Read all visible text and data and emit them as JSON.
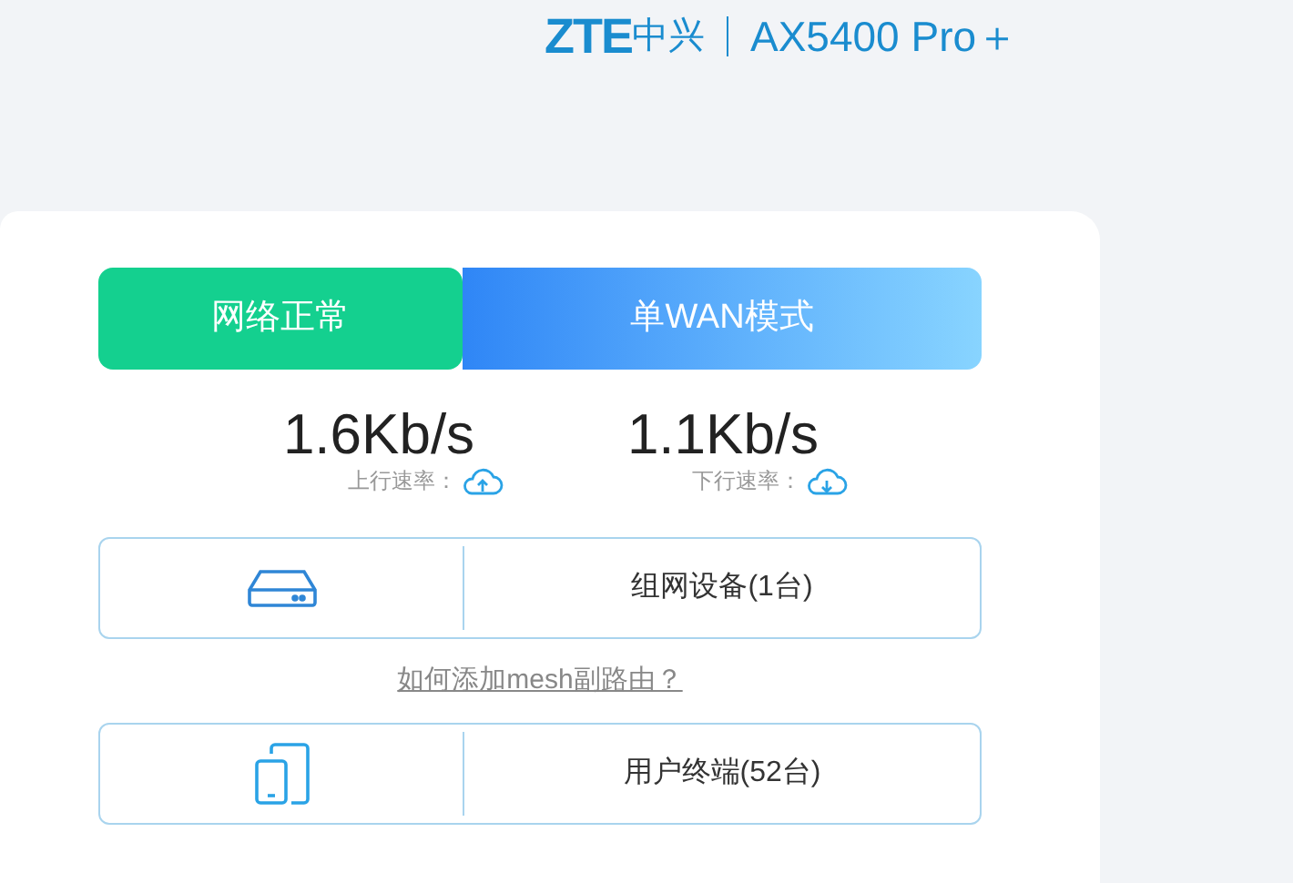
{
  "header": {
    "logo": "ZTE",
    "logo_cn": "中兴",
    "model": "AX5400 Pro＋"
  },
  "status_bar": [
    {
      "kind": "status",
      "label": "网络正常"
    },
    {
      "kind": "mode",
      "label": "单WAN模式"
    }
  ],
  "speeds": [
    {
      "kind": "upload",
      "value": "1.6Kb/s",
      "label": "上行速率："
    },
    {
      "kind": "download",
      "value": "1.1Kb/s",
      "label": "下行速率："
    }
  ],
  "devices": [
    {
      "kind": "mesh",
      "label": "组网设备(1台)"
    },
    {
      "kind": "terminal",
      "label": "用户终端(52台)"
    }
  ],
  "help_link": "如何添加mesh副路由？"
}
